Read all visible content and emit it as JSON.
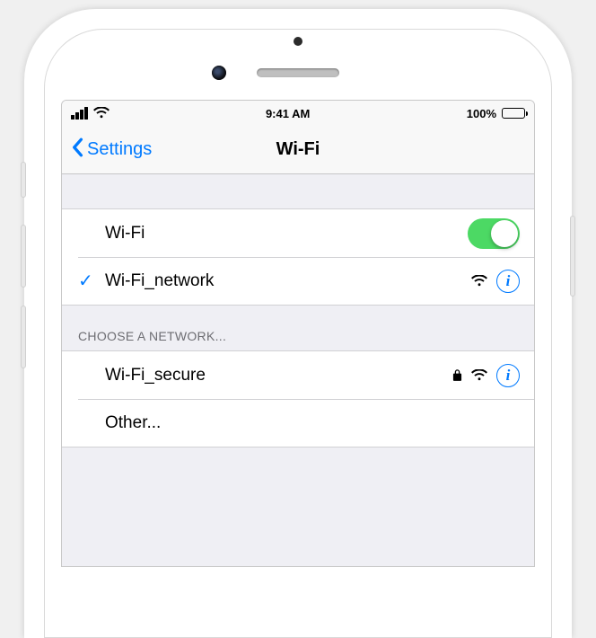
{
  "status": {
    "time": "9:41 AM",
    "battery_text": "100%"
  },
  "nav": {
    "back_label": "Settings",
    "title": "Wi-Fi"
  },
  "toggle_row": {
    "label": "Wi-Fi",
    "on": true
  },
  "connected": {
    "name": "Wi-Fi_network"
  },
  "choose_header": "CHOOSE A NETWORK...",
  "networks": [
    {
      "name": "Wi-Fi_secure",
      "secured": true
    }
  ],
  "other_label": "Other..."
}
